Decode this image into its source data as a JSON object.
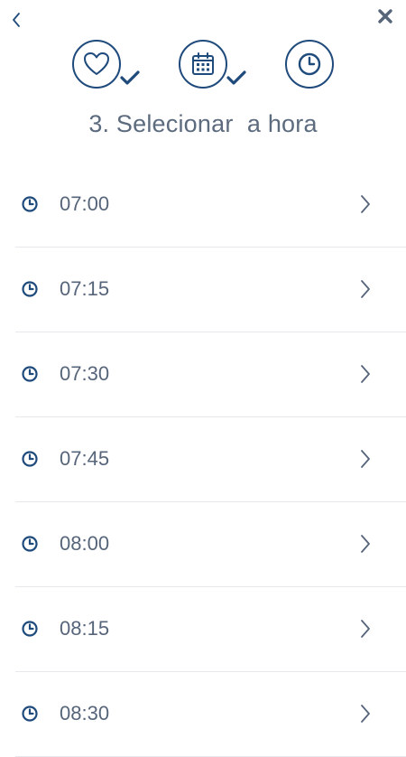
{
  "header": {
    "back_icon": "chevron-left-icon",
    "close_icon": "close-x-icon"
  },
  "steps": [
    {
      "icon": "heart-icon",
      "completed": true
    },
    {
      "icon": "calendar-icon",
      "completed": true
    },
    {
      "icon": "clock-icon",
      "completed": false
    }
  ],
  "title": "3. Selecionar  a hora",
  "times": [
    {
      "label": "07:00"
    },
    {
      "label": "07:15"
    },
    {
      "label": "07:30"
    },
    {
      "label": "07:45"
    },
    {
      "label": "08:00"
    },
    {
      "label": "08:15"
    },
    {
      "label": "08:30"
    }
  ],
  "colors": {
    "primary": "#1f4a7c",
    "text": "#56657a",
    "divider": "#e6e8eb"
  }
}
